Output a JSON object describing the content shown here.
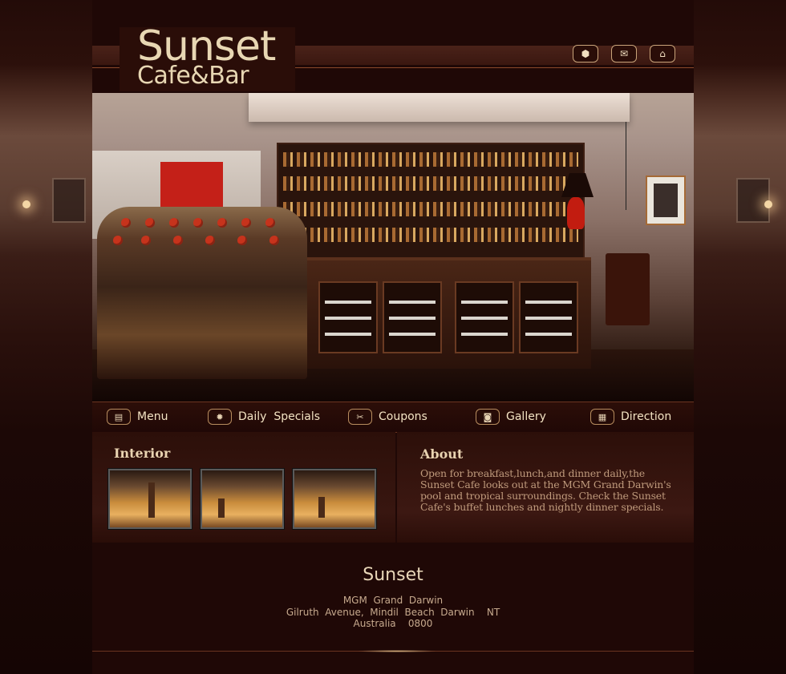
{
  "brand": {
    "title": "Sunset",
    "subtitle": "Cafe&Bar"
  },
  "top_icons": [
    {
      "name": "cube-icon",
      "glyph": "⬢"
    },
    {
      "name": "mail-icon",
      "glyph": "✉"
    },
    {
      "name": "home-icon",
      "glyph": "⌂"
    }
  ],
  "nav": [
    {
      "label": "Menu",
      "icon": "menu-icon",
      "glyph": "▤"
    },
    {
      "label": "Daily  Specials",
      "icon": "sun-icon",
      "glyph": "✹"
    },
    {
      "label": "Coupons",
      "icon": "scissors-icon",
      "glyph": "✂"
    },
    {
      "label": "Gallery",
      "icon": "camera-icon",
      "glyph": "◙"
    },
    {
      "label": "Direction",
      "icon": "map-icon",
      "glyph": "▦"
    }
  ],
  "interior": {
    "heading": "Interior"
  },
  "about": {
    "heading": "About",
    "text": "Open for breakfast,lunch,and dinner daily,the Sunset Cafe looks out at the MGM  Grand Darwin's pool and tropical surroundings. Check the Sunset Cafe's buffet lunches and nightly dinner specials."
  },
  "footer": {
    "name": "Sunset",
    "line1": "MGM  Grand  Darwin",
    "line2": "Gilruth  Avenue,  Mindil  Beach  Darwin    NT",
    "line3": "Australia    0800"
  },
  "colors": {
    "background": "#1c0806",
    "accent": "#e8d7b3",
    "nav_border": "#b78c5e"
  }
}
